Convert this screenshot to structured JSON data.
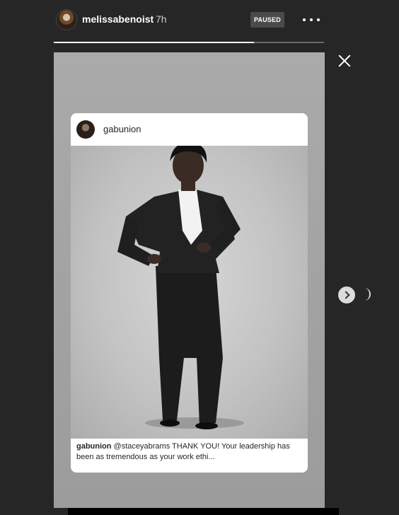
{
  "header": {
    "username": "melissabenoist",
    "time_ago": "7h",
    "paused_label": "PAUSED",
    "progress": 0.74
  },
  "card": {
    "username": "gabunion",
    "caption_user": "gabunion",
    "caption_text": " @staceyabrams THANK YOU! Your leadership has been as tremendous as your work ethi..."
  },
  "icons": {
    "more": "more-options-icon",
    "close": "close-icon",
    "next": "chevron-right-icon"
  }
}
